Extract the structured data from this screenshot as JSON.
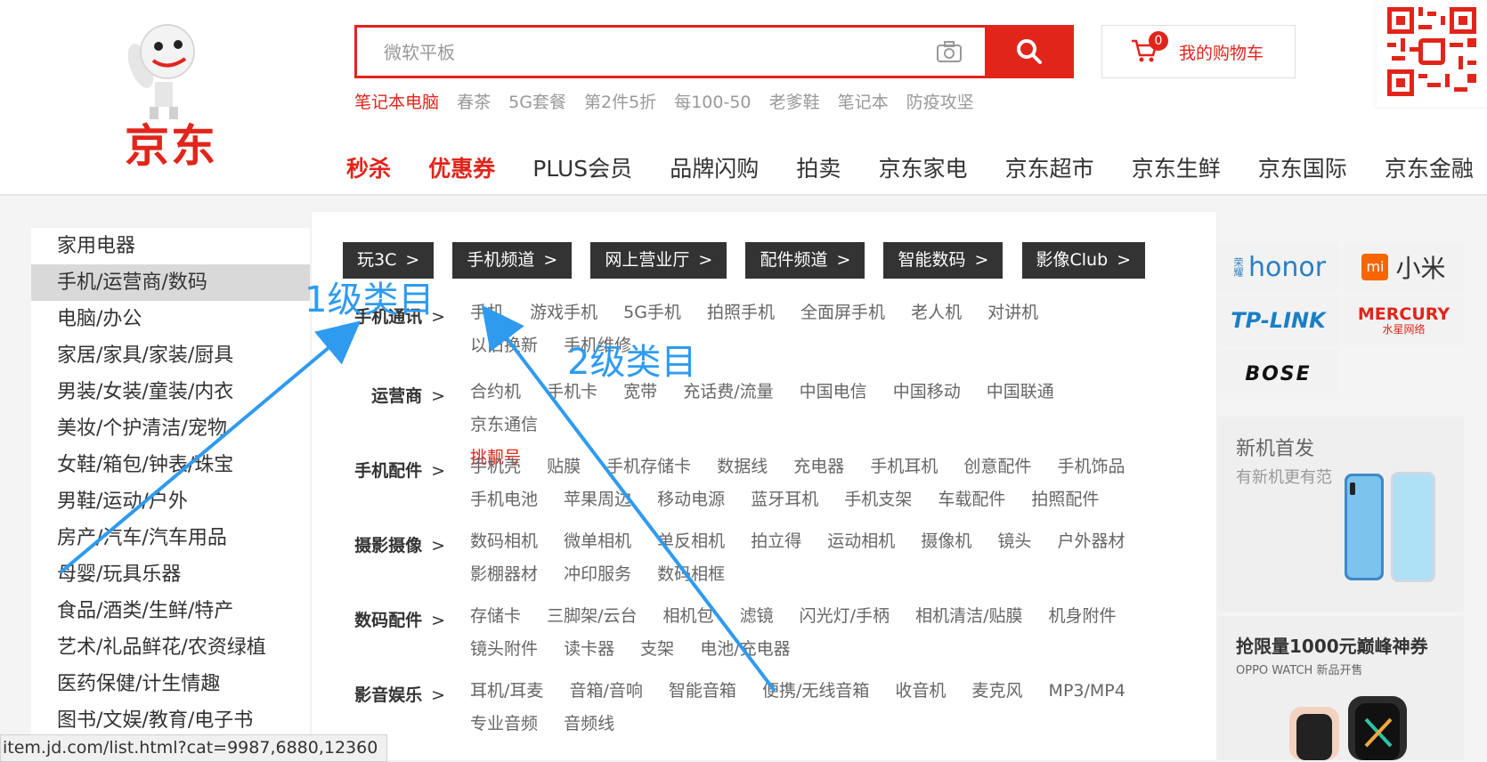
{
  "header": {
    "logo_text": "京东",
    "search": {
      "placeholder": "微软平板"
    },
    "hot_words": [
      "笔记本电脑",
      "春茶",
      "5G套餐",
      "第2件5折",
      "每100-50",
      "老爹鞋",
      "笔记本",
      "防疫攻坚"
    ],
    "cart": {
      "count": "0",
      "label": "我的购物车"
    },
    "nav": [
      "秒杀",
      "优惠券",
      "PLUS会员",
      "品牌闪购",
      "拍卖",
      "京东家电",
      "京东超市",
      "京东生鲜",
      "京东国际",
      "京东金融"
    ]
  },
  "sidebar": {
    "items": [
      "家用电器",
      "手机/运营商/数码",
      "电脑/办公",
      "家居/家具/家装/厨具",
      "男装/女装/童装/内衣",
      "美妆/个护清洁/宠物",
      "女鞋/箱包/钟表/珠宝",
      "男鞋/运动/户外",
      "房产/汽车/汽车用品",
      "母婴/玩具乐器",
      "食品/酒类/生鲜/特产",
      "艺术/礼品鲜花/农资绿植",
      "医药保健/计生情趣",
      "图书/文娱/教育/电子书"
    ]
  },
  "flyout": {
    "channels": [
      "玩3C",
      "手机频道",
      "网上营业厅",
      "配件频道",
      "智能数码",
      "影像Club"
    ],
    "chevron": ">",
    "categories": [
      {
        "title": "手机通讯",
        "links": [
          "手机",
          "游戏手机",
          "5G手机",
          "拍照手机",
          "全面屏手机",
          "老人机",
          "对讲机",
          "以旧换新",
          "手机维修"
        ]
      },
      {
        "title": "运营商",
        "links": [
          "合约机",
          "手机卡",
          "宽带",
          "充话费/流量",
          "中国电信",
          "中国移动",
          "中国联通",
          "京东通信",
          "挑靓号"
        ]
      },
      {
        "title": "手机配件",
        "links": [
          "手机壳",
          "贴膜",
          "手机存储卡",
          "数据线",
          "充电器",
          "手机耳机",
          "创意配件",
          "手机饰品",
          "手机电池",
          "苹果周边",
          "移动电源",
          "蓝牙耳机",
          "手机支架",
          "车载配件",
          "拍照配件"
        ]
      },
      {
        "title": "摄影摄像",
        "links": [
          "数码相机",
          "微单相机",
          "单反相机",
          "拍立得",
          "运动相机",
          "摄像机",
          "镜头",
          "户外器材",
          "影棚器材",
          "冲印服务",
          "数码相框"
        ]
      },
      {
        "title": "数码配件",
        "links": [
          "存储卡",
          "三脚架/云台",
          "相机包",
          "滤镜",
          "闪光灯/手柄",
          "相机清洁/贴膜",
          "机身附件",
          "镜头附件",
          "读卡器",
          "支架",
          "电池/充电器"
        ]
      },
      {
        "title": "影音娱乐",
        "links": [
          "耳机/耳麦",
          "音箱/音响",
          "智能音箱",
          "便携/无线音箱",
          "收音机",
          "麦克风",
          "MP3/MP4",
          "专业音频",
          "音频线"
        ]
      }
    ]
  },
  "brands": [
    "荣耀 honor",
    "mi 小米",
    "TP-LINK",
    "MERCURY",
    "水星网络",
    "BOSE"
  ],
  "promos": [
    {
      "title": "新机首发",
      "subtitle": "有新机更有范"
    },
    {
      "title": "抢限量1000元巅峰神券",
      "subtitle": "OPPO WATCH 新品开售"
    }
  ],
  "annotations": {
    "level1": "1级类目",
    "level2": "2级类目"
  },
  "status_url": "item.jd.com/list.html?cat=9987,6880,12360",
  "colors": {
    "accent": "#e1251b",
    "annotation": "#2f9bef",
    "channel_bg": "#333333"
  }
}
